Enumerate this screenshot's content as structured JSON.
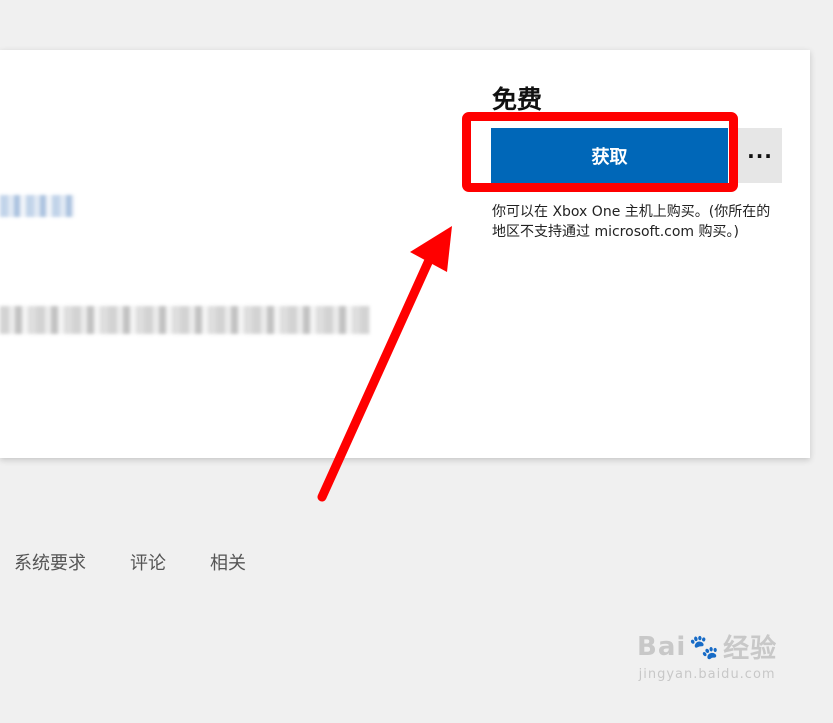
{
  "product": {
    "price": "免费",
    "get_button_label": "获取",
    "more_button_label": "···",
    "purchase_note": "你可以在 Xbox One 主机上购买。(你所在的地区不支持通过 microsoft.com 购买。)"
  },
  "tabs": [
    {
      "label": "系统要求"
    },
    {
      "label": "评论"
    },
    {
      "label": "相关"
    }
  ],
  "watermark": {
    "main_text": "Bai",
    "main_text_2": "经验",
    "paw_icon": "paw-icon",
    "sub_text": "jingyan.baidu.com"
  },
  "annotation": {
    "highlight_color": "#ff0000",
    "accent_color": "#0067b8"
  }
}
